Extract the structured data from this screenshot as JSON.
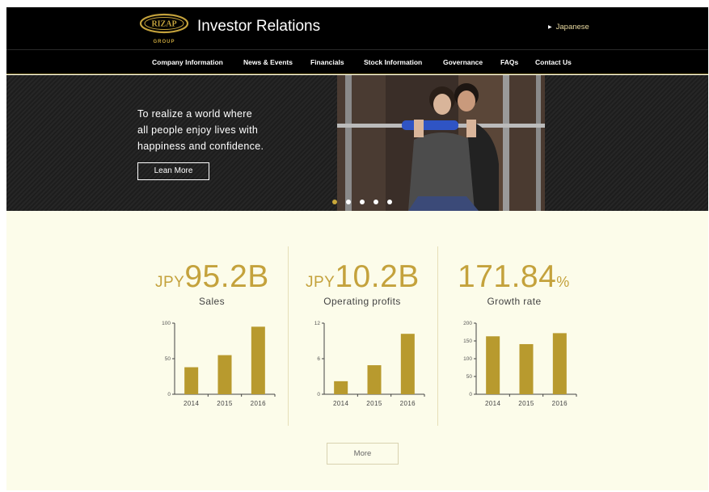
{
  "header": {
    "logo_text": "RIZAP",
    "logo_sub": "GROUP",
    "title": "Investor Relations",
    "language_link": "Japanese"
  },
  "nav": {
    "items": [
      {
        "label": "Company Information"
      },
      {
        "label": "News & Events"
      },
      {
        "label": "Financials"
      },
      {
        "label": "Stock Information"
      },
      {
        "label": "Governance"
      },
      {
        "label": "FAQs"
      },
      {
        "label": "Contact Us"
      }
    ]
  },
  "hero": {
    "line1": "To realize a world where",
    "line2": "all people enjoy lives with",
    "line3": "happiness and confidence.",
    "button_label": "Lean More",
    "slide_count": 5,
    "active_slide": 1
  },
  "stats": [
    {
      "prefix": "JPY",
      "value": "95.2B",
      "suffix": "",
      "label": "Sales"
    },
    {
      "prefix": "JPY",
      "value": "10.2B",
      "suffix": "",
      "label": "Operating profits"
    },
    {
      "prefix": "",
      "value": "171.84",
      "suffix": "%",
      "label": "Growth rate"
    }
  ],
  "more_button": "More",
  "colors": {
    "accent_gold": "#c4a23c",
    "bar_gold": "#b89a2e",
    "header_bg": "#000000",
    "page_bg": "#fcfcea"
  },
  "chart_data": [
    {
      "type": "bar",
      "categories": [
        "2014",
        "2015",
        "2016"
      ],
      "values": [
        38,
        55,
        95
      ],
      "ylim": [
        0,
        100
      ],
      "yticks": [
        "0",
        "50",
        "100"
      ],
      "xlabel": "",
      "ylabel": "",
      "title": ""
    },
    {
      "type": "bar",
      "categories": [
        "2014",
        "2015",
        "2016"
      ],
      "values": [
        2.2,
        4.9,
        10.2
      ],
      "ylim": [
        0,
        12
      ],
      "yticks": [
        "0",
        "6",
        "12"
      ],
      "xlabel": "",
      "ylabel": "",
      "title": ""
    },
    {
      "type": "bar",
      "categories": [
        "2014",
        "2015",
        "2016"
      ],
      "values": [
        163,
        141,
        171.84
      ],
      "ylim": [
        0,
        200
      ],
      "yticks": [
        "0",
        "50",
        "100",
        "150",
        "200"
      ],
      "xlabel": "",
      "ylabel": "",
      "title": ""
    }
  ]
}
